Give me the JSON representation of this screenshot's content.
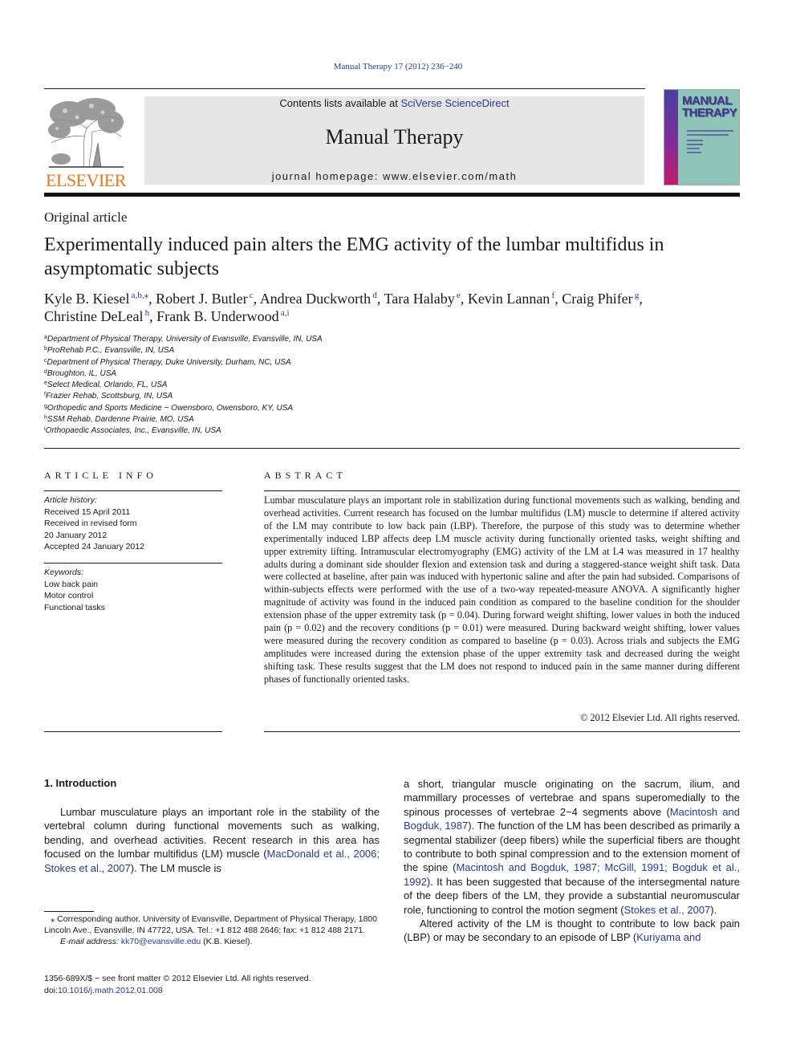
{
  "running_head": "Manual Therapy 17 (2012) 236−240",
  "masthead": {
    "publisher_logo_text": "ELSEVIER",
    "contents_prefix": "Contents lists available at ",
    "contents_link": "SciVerse ScienceDirect",
    "journal_name": "Manual Therapy",
    "homepage": "journal homepage: www.elsevier.com/math",
    "cover_title_line1": "MANUAL",
    "cover_title_line2": "THERAPY"
  },
  "colors": {
    "link": "#2a3a8c",
    "elsevier_orange": "#e87722",
    "masthead_bg": "#e6e6e6",
    "cover_teal": "#8fc5b9"
  },
  "article": {
    "type": "Original article",
    "title": "Experimentally induced pain alters the EMG activity of the lumbar multifidus in asymptomatic subjects",
    "authors": [
      {
        "name": "Kyle B. Kiesel",
        "sup": "a,b,⁎",
        "sep": ", "
      },
      {
        "name": "Robert J. Butler",
        "sup": "c",
        "sep": ", "
      },
      {
        "name": "Andrea Duckworth",
        "sup": "d",
        "sep": ", "
      },
      {
        "name": "Tara Halaby",
        "sup": "e",
        "sep": ", "
      },
      {
        "name": "Kevin Lannan",
        "sup": "f",
        "sep": ", "
      },
      {
        "name": "Craig Phifer",
        "sup": "g",
        "sep": ","
      },
      {
        "name": "Christine DeLeal",
        "sup": "h",
        "sep": ", "
      },
      {
        "name": "Frank B. Underwood",
        "sup": "a,i",
        "sep": ""
      }
    ],
    "affiliations": [
      {
        "key": "a",
        "text": "Department of Physical Therapy, University of Evansville, Evansville, IN, USA"
      },
      {
        "key": "b",
        "text": "ProRehab P.C., Evansville, IN, USA"
      },
      {
        "key": "c",
        "text": "Department of Physical Therapy, Duke University, Durham, NC, USA"
      },
      {
        "key": "d",
        "text": "Broughton, IL, USA"
      },
      {
        "key": "e",
        "text": "Select Medical, Orlando, FL, USA"
      },
      {
        "key": "f",
        "text": "Frazier Rehab, Scottsburg, IN, USA"
      },
      {
        "key": "g",
        "text": "Orthopedic and Sports Medicine − Owensboro, Owensboro, KY, USA"
      },
      {
        "key": "h",
        "text": "SSM Rehab, Dardenne Prairie, MO, USA"
      },
      {
        "key": "i",
        "text": "Orthopaedic Associates, Inc., Evansville, IN, USA"
      }
    ]
  },
  "article_info": {
    "label": "ARTICLE INFO",
    "history_heading": "Article history:",
    "history": [
      "Received 15 April 2011",
      "Received in revised form",
      "20 January 2012",
      "Accepted 24 January 2012"
    ],
    "keywords_heading": "Keywords:",
    "keywords": [
      "Low back pain",
      "Motor control",
      "Functional tasks"
    ]
  },
  "abstract": {
    "label": "ABSTRACT",
    "text": "Lumbar musculature plays an important role in stabilization during functional movements such as walking, bending and overhead activities. Current research has focused on the lumbar multifidus (LM) muscle to determine if altered activity of the LM may contribute to low back pain (LBP). Therefore, the purpose of this study was to determine whether experimentally induced LBP affects deep LM muscle activity during functionally oriented tasks, weight shifting and upper extremity lifting. Intramuscular electromyography (EMG) activity of the LM at L4 was measured in 17 healthy adults during a dominant side shoulder flexion and extension task and during a staggered-stance weight shift task. Data were collected at baseline, after pain was induced with hypertonic saline and after the pain had subsided. Comparisons of within-subjects effects were performed with the use of a two-way repeated-measure ANOVA. A significantly higher magnitude of activity was found in the induced pain condition as compared to the baseline condition for the shoulder extension phase of the upper extremity task (p = 0.04). During forward weight shifting, lower values in both the induced pain (p = 0.02) and the recovery conditions (p = 0.01) were measured. During backward weight shifting, lower values were measured during the recovery condition as compared to baseline (p = 0.03). Across trials and subjects the EMG amplitudes were increased during the extension phase of the upper extremity task and decreased during the weight shifting task. These results suggest that the LM does not respond to induced pain in the same manner during different phases of functionally oriented tasks.",
    "copyright": "© 2012 Elsevier Ltd. All rights reserved."
  },
  "body": {
    "section_heading": "1.  Introduction",
    "left_para": [
      {
        "t": "Lumbar musculature plays an important role in the stability of the vertebral column during functional movements such as walking, bending, and overhead activities. Recent research in this area has focused on the lumbar multifidus (LM) muscle ("
      },
      {
        "link": "MacDonald et al., 2006; Stokes et al., 2007"
      },
      {
        "t": "). The LM muscle is"
      }
    ],
    "right_para1": [
      {
        "t": "a short, triangular muscle originating on the sacrum, ilium, and mammillary processes of vertebrae and spans superomedially to the spinous processes of vertebrae 2−4 segments above ("
      },
      {
        "link": "Macintosh and Bogduk, 1987"
      },
      {
        "t": "). The function of the LM has been described as primarily a segmental stabilizer (deep fibers) while the superficial fibers are thought to contribute to both spinal compression and to the extension moment of the spine ("
      },
      {
        "link": "Macintosh and Bogduk, 1987; McGill, 1991; Bogduk et al., 1992"
      },
      {
        "t": "). It has been suggested that because of the intersegmental nature of the deep fibers of the LM, they provide a substantial neuromuscular role, functioning to control the motion segment ("
      },
      {
        "link": "Stokes et al., 2007"
      },
      {
        "t": ")."
      }
    ],
    "right_para2": [
      {
        "t": "Altered activity of the LM is thought to contribute to low back pain (LBP) or may be secondary to an episode of LBP ("
      },
      {
        "link": "Kuriyama and"
      }
    ]
  },
  "footnote": {
    "corresponding": "⁎  Corresponding author. University of Evansville, Department of Physical Therapy, 1800 Lincoln Ave., Evansville, IN 47722, USA. Tel.: +1 812 488 2646; fax: +1 812 488 2171.",
    "email_label": "E-mail address: ",
    "email": "kk70@evansville.edu",
    "email_suffix": " (K.B. Kiesel)."
  },
  "front_matter": {
    "issn_line": "1356-689X/$ − see front matter © 2012 Elsevier Ltd. All rights reserved.",
    "doi_prefix": "doi:",
    "doi": "10.1016/j.math.2012.01.008"
  }
}
